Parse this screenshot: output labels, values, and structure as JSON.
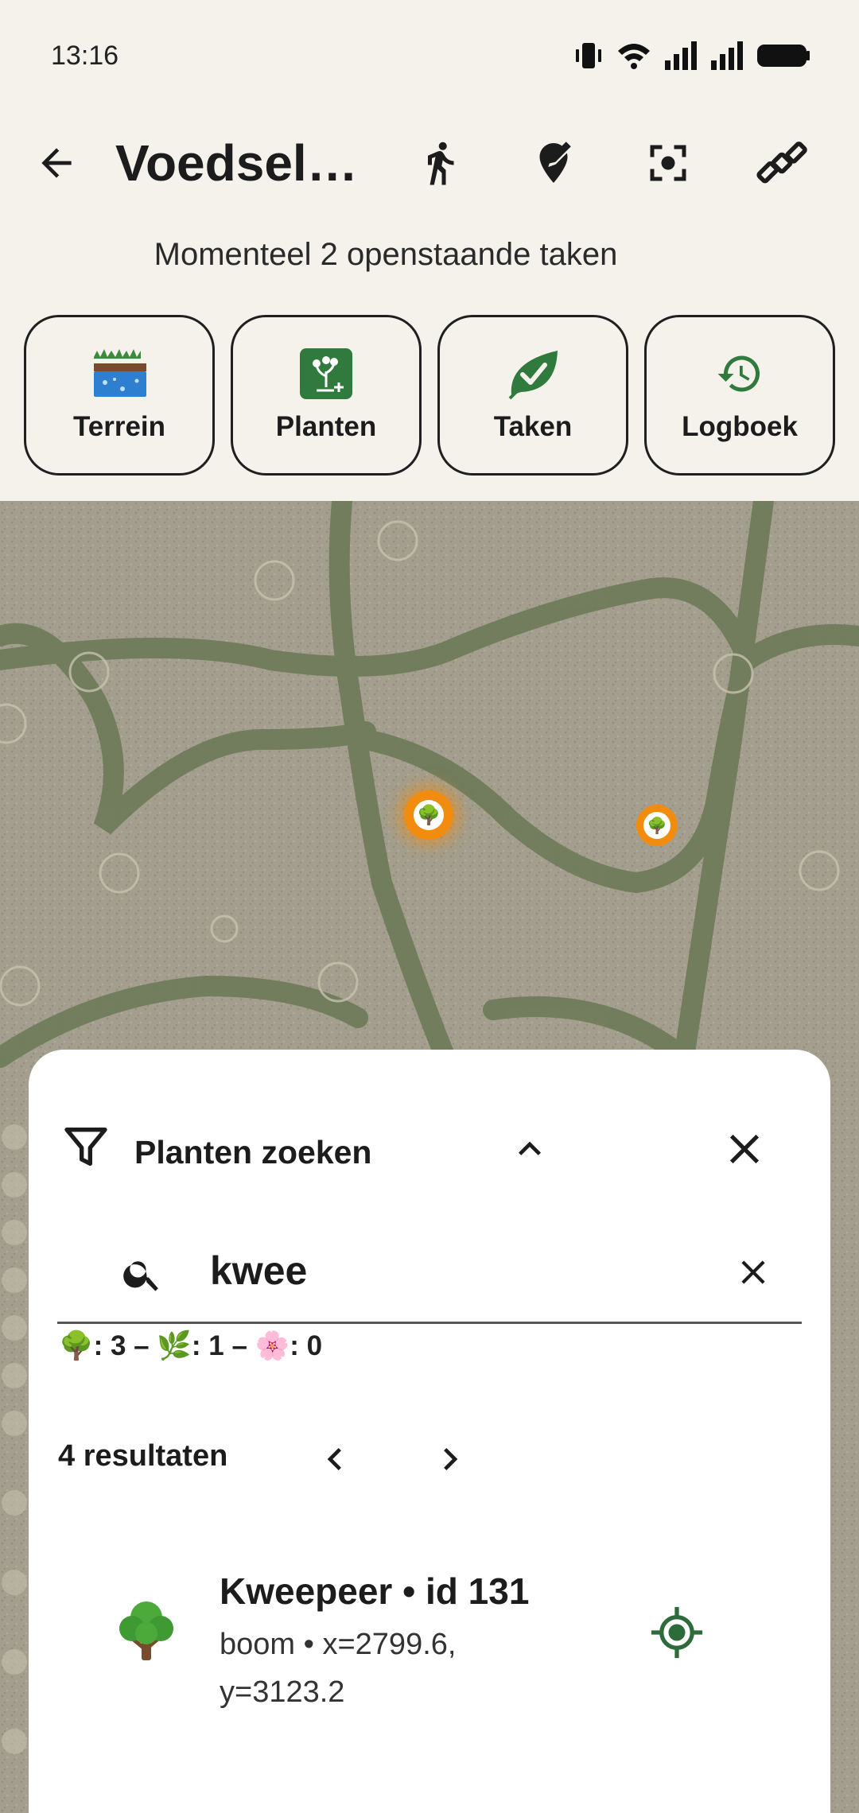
{
  "status": {
    "time": "13:16"
  },
  "appbar": {
    "title": "Voedselbos",
    "actions": [
      "walk-icon",
      "edit-location-icon",
      "focus-icon",
      "satellite-icon"
    ]
  },
  "subtitle": "Momenteel 2 openstaande taken",
  "categories": [
    {
      "label": "Terrein",
      "icon": "terrain-icon"
    },
    {
      "label": "Planten",
      "icon": "plant-add-icon"
    },
    {
      "label": "Taken",
      "icon": "leaf-check-icon"
    },
    {
      "label": "Logboek",
      "icon": "history-icon"
    }
  ],
  "sheet": {
    "title": "Planten zoeken",
    "search": {
      "value": "kwee"
    },
    "counts": "🌳: 3 – 🌿: 1 – 🌸: 0",
    "results_label": "4 resultaten",
    "result": {
      "emoji": "🌳",
      "title": "Kweepeer • id 131",
      "subtitle": "boom • x=2799.6, y=3123.2"
    }
  },
  "colors": {
    "background": "#f4f2eb",
    "accent_green": "#2e6b3a",
    "marker_orange": "#f28c0f"
  }
}
